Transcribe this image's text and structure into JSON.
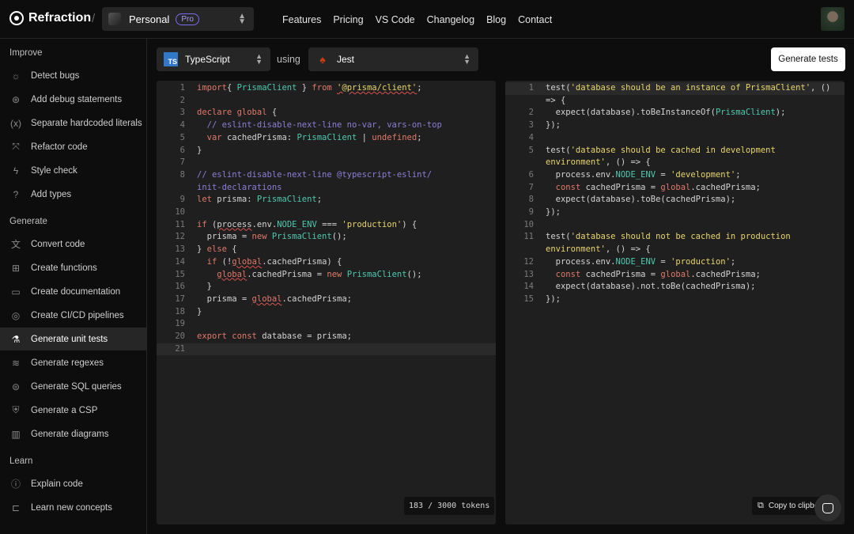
{
  "header": {
    "brand": "Refraction",
    "workspace": "Personal",
    "plan_badge": "Pro",
    "nav": [
      "Features",
      "Pricing",
      "VS Code",
      "Changelog",
      "Blog",
      "Contact"
    ]
  },
  "sidebar": {
    "sections": [
      {
        "title": "Improve",
        "items": [
          {
            "label": "Detect bugs",
            "icon": "bug-icon"
          },
          {
            "label": "Add debug statements",
            "icon": "debug-icon"
          },
          {
            "label": "Separate hardcoded literals",
            "icon": "variable-icon"
          },
          {
            "label": "Refactor code",
            "icon": "refactor-icon"
          },
          {
            "label": "Style check",
            "icon": "lightning-icon"
          },
          {
            "label": "Add types",
            "icon": "question-icon"
          }
        ]
      },
      {
        "title": "Generate",
        "items": [
          {
            "label": "Convert code",
            "icon": "translate-icon"
          },
          {
            "label": "Create functions",
            "icon": "gift-icon"
          },
          {
            "label": "Create documentation",
            "icon": "book-icon"
          },
          {
            "label": "Create CI/CD pipelines",
            "icon": "pipeline-icon"
          },
          {
            "label": "Generate unit tests",
            "icon": "flask-icon",
            "active": true
          },
          {
            "label": "Generate regexes",
            "icon": "regex-icon"
          },
          {
            "label": "Generate SQL queries",
            "icon": "database-icon"
          },
          {
            "label": "Generate a CSP",
            "icon": "shield-icon"
          },
          {
            "label": "Generate diagrams",
            "icon": "chart-icon"
          }
        ]
      },
      {
        "title": "Learn",
        "items": [
          {
            "label": "Explain code",
            "icon": "info-icon"
          },
          {
            "label": "Learn new concepts",
            "icon": "bookmark-icon"
          }
        ]
      }
    ]
  },
  "toolbar": {
    "language": "TypeScript",
    "language_logo": "TS",
    "using": "using",
    "framework": "Jest",
    "generate_button": "Generate tests"
  },
  "input_code": {
    "token_count": "183 / 3000 tokens",
    "lines": [
      [
        [
          "kw",
          "import"
        ],
        [
          "",
          "{ "
        ],
        [
          "cls",
          "PrismaClient"
        ],
        [
          "",
          " } "
        ],
        [
          "kw",
          "from"
        ],
        [
          "",
          " "
        ],
        [
          "str sq",
          "'@prisma/client'"
        ],
        [
          "",
          ";"
        ]
      ],
      [],
      [
        [
          "kw",
          "declare"
        ],
        [
          "",
          " "
        ],
        [
          "kw",
          "global"
        ],
        [
          "",
          " {"
        ]
      ],
      [
        [
          "",
          "  "
        ],
        [
          "cmt",
          "// eslint-disable-next-line no-var, vars-on-top"
        ]
      ],
      [
        [
          "",
          "  "
        ],
        [
          "kw",
          "var"
        ],
        [
          "",
          " cachedPrisma: "
        ],
        [
          "cls",
          "PrismaClient"
        ],
        [
          "",
          " | "
        ],
        [
          "kw",
          "undefined"
        ],
        [
          "",
          ";"
        ]
      ],
      [
        [
          "",
          "}"
        ]
      ],
      [],
      [
        [
          "cmt",
          "// eslint-disable-next-line @typescript-eslint/"
        ]
      ],
      [
        [
          "kw",
          "let"
        ],
        [
          "",
          " prisma: "
        ],
        [
          "cls",
          "PrismaClient"
        ],
        [
          "",
          ";"
        ]
      ],
      [],
      [
        [
          "kw",
          "if"
        ],
        [
          "",
          " ("
        ],
        [
          "sq",
          "process"
        ],
        [
          "",
          ".env."
        ],
        [
          "cls",
          "NODE_ENV"
        ],
        [
          "",
          " === "
        ],
        [
          "str",
          "'production'"
        ],
        [
          "",
          ") {"
        ]
      ],
      [
        [
          "",
          "  prisma = "
        ],
        [
          "kw",
          "new"
        ],
        [
          "",
          " "
        ],
        [
          "cls",
          "PrismaClient"
        ],
        [
          "",
          "();"
        ]
      ],
      [
        [
          "",
          "} "
        ],
        [
          "kw",
          "else"
        ],
        [
          "",
          " {"
        ]
      ],
      [
        [
          "",
          "  "
        ],
        [
          "kw",
          "if"
        ],
        [
          "",
          " (!"
        ],
        [
          "kw sq",
          "global"
        ],
        [
          "",
          ".cachedPrisma) {"
        ]
      ],
      [
        [
          "",
          "    "
        ],
        [
          "kw sq",
          "global"
        ],
        [
          "",
          ".cachedPrisma = "
        ],
        [
          "kw",
          "new"
        ],
        [
          "",
          " "
        ],
        [
          "cls",
          "PrismaClient"
        ],
        [
          "",
          "();"
        ]
      ],
      [
        [
          "",
          "  }"
        ]
      ],
      [
        [
          "",
          "  prisma = "
        ],
        [
          "kw sq",
          "global"
        ],
        [
          "",
          ".cachedPrisma;"
        ]
      ],
      [
        [
          "",
          "}"
        ]
      ],
      [],
      [
        [
          "kw",
          "export"
        ],
        [
          "",
          " "
        ],
        [
          "kw",
          "const"
        ],
        [
          "",
          " database = prisma;"
        ]
      ],
      []
    ],
    "wrapped": {
      "7": [
        [
          "cmt",
          "init-declarations"
        ]
      ]
    }
  },
  "output_code": {
    "copy_label": "Copy to clipboard",
    "lines": [
      [
        [
          "",
          "test("
        ],
        [
          "str",
          "'database should be an instance of PrismaClient'"
        ],
        [
          "",
          ", () "
        ]
      ],
      [
        [
          "",
          "  expect(database).toBeInstanceOf("
        ],
        [
          "cls",
          "PrismaClient"
        ],
        [
          "",
          ");"
        ]
      ],
      [
        [
          "",
          "});"
        ]
      ],
      [],
      [
        [
          "",
          "test("
        ],
        [
          "str",
          "'database should be cached in development "
        ]
      ],
      [
        [
          "",
          "  process.env."
        ],
        [
          "cls",
          "NODE_ENV"
        ],
        [
          "",
          " = "
        ],
        [
          "str",
          "'development'"
        ],
        [
          "",
          ";"
        ]
      ],
      [
        [
          "",
          "  "
        ],
        [
          "kw",
          "const"
        ],
        [
          "",
          " cachedPrisma = "
        ],
        [
          "kw",
          "global"
        ],
        [
          "",
          ".cachedPrisma;"
        ]
      ],
      [
        [
          "",
          "  expect(database).toBe(cachedPrisma);"
        ]
      ],
      [
        [
          "",
          "});"
        ]
      ],
      [],
      [
        [
          "",
          "test("
        ],
        [
          "str",
          "'database should not be cached in production "
        ]
      ],
      [
        [
          "",
          "  process.env."
        ],
        [
          "cls",
          "NODE_ENV"
        ],
        [
          "",
          " = "
        ],
        [
          "str",
          "'production'"
        ],
        [
          "",
          ";"
        ]
      ],
      [
        [
          "",
          "  "
        ],
        [
          "kw",
          "const"
        ],
        [
          "",
          " cachedPrisma = "
        ],
        [
          "kw",
          "global"
        ],
        [
          "",
          ".cachedPrisma;"
        ]
      ],
      [
        [
          "",
          "  expect(database).not.toBe(cachedPrisma);"
        ]
      ],
      [
        [
          "",
          "});"
        ]
      ]
    ],
    "wrapped": {
      "0": [
        [
          "",
          "=> {"
        ]
      ],
      "4": [
        [
          "str",
          "environment'"
        ],
        [
          "",
          ", () => {"
        ]
      ],
      "10": [
        [
          "str",
          "environment'"
        ],
        [
          "",
          ", () => {"
        ]
      ]
    }
  }
}
